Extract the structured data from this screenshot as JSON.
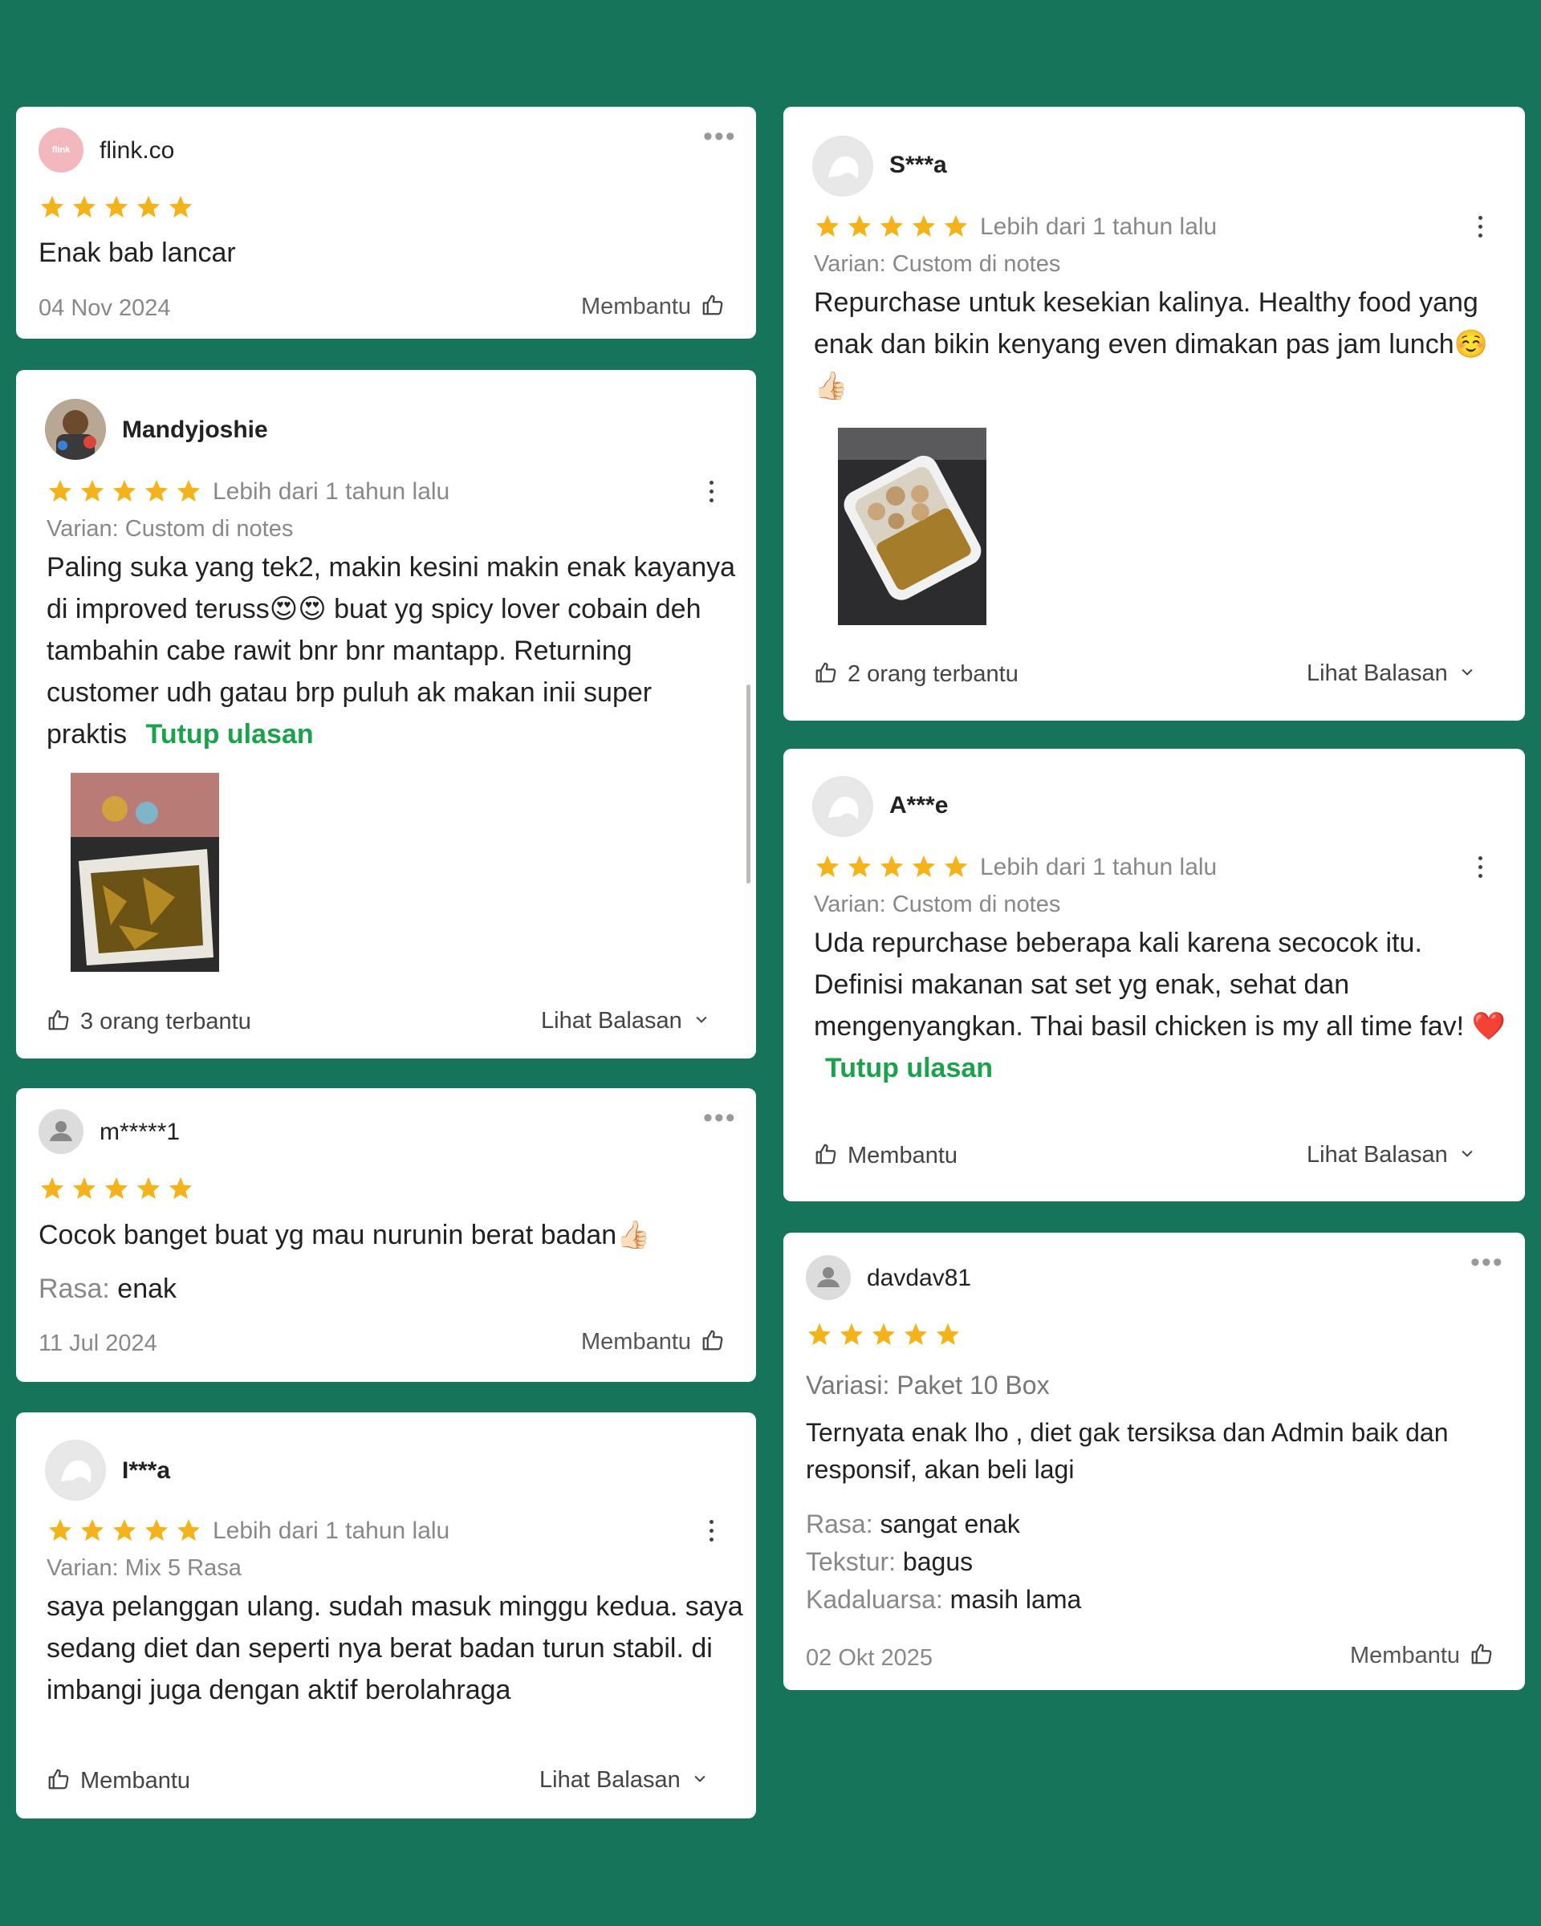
{
  "colors": {
    "background": "#157459",
    "star": "#f5b31b",
    "green_link": "#1aa34a"
  },
  "left_column": {
    "review1": {
      "avatar_text": "flink",
      "username": "flink.co",
      "rating": 5,
      "text": "Enak bab lancar",
      "date": "04 Nov 2024",
      "helpful_label": "Membantu"
    },
    "review2": {
      "username": "Mandyjoshie",
      "rating": 5,
      "time": "Lebih dari 1 tahun lalu",
      "variant": "Varian: Custom di notes",
      "text": "Paling suka yang tek2, makin kesini makin enak kayanya di improved teruss😍😍 buat yg spicy lover cobain deh tambahin cabe rawit bnr bnr mantapp. Returning customer udh gatau brp puluh ak makan inii super praktis",
      "collapse_link": "Tutup ulasan",
      "helpful_count": "3 orang terbantu",
      "replies_label": "Lihat Balasan"
    },
    "review3": {
      "username": "m*****1",
      "rating": 5,
      "text": "Cocok banget buat yg mau nurunin berat badan👍🏻",
      "taste_label": "Rasa:",
      "taste_value": "enak",
      "date": "11 Jul 2024",
      "helpful_label": "Membantu"
    },
    "review4": {
      "username": "I***a",
      "rating": 5,
      "time": "Lebih dari 1 tahun lalu",
      "variant": "Varian: Mix 5 Rasa",
      "text": "saya pelanggan ulang. sudah masuk minggu kedua. saya sedang diet dan seperti nya berat badan turun stabil. di imbangi juga dengan aktif berolahraga",
      "helpful_label": "Membantu",
      "replies_label": "Lihat Balasan"
    }
  },
  "right_column": {
    "review1": {
      "username": "S***a",
      "rating": 5,
      "time": "Lebih dari 1 tahun lalu",
      "variant": "Varian: Custom di notes",
      "text": "Repurchase untuk kesekian kalinya. Healthy food yang enak dan bikin kenyang even dimakan pas jam lunch☺️👍🏻",
      "helpful_count": "2 orang terbantu",
      "replies_label": "Lihat Balasan"
    },
    "review2": {
      "username": "A***e",
      "rating": 5,
      "time": "Lebih dari 1 tahun lalu",
      "variant": "Varian: Custom di notes",
      "text": "Uda repurchase beberapa kali karena secocok itu. Definisi makanan sat set yg enak, sehat dan mengenyangkan. Thai basil chicken is my all time fav! ❤️",
      "collapse_link": "Tutup ulasan",
      "helpful_label": "Membantu",
      "replies_label": "Lihat Balasan"
    },
    "review3": {
      "username": "davdav81",
      "rating": 5,
      "variant": "Variasi: Paket 10 Box",
      "text": "Ternyata enak lho , diet gak tersiksa dan Admin baik dan responsif, akan beli lagi",
      "taste_label": "Rasa:",
      "taste_value": "sangat enak",
      "texture_label": "Tekstur:",
      "texture_value": "bagus",
      "expiry_label": "Kadaluarsa:",
      "expiry_value": "masih lama",
      "date": "02 Okt 2025",
      "helpful_label": "Membantu"
    }
  },
  "icons": {
    "star": "star-icon",
    "thumb": "thumbs-up-icon",
    "more_h": "more-horizontal-icon",
    "more_v": "more-vertical-icon",
    "chevron": "chevron-down-icon"
  }
}
